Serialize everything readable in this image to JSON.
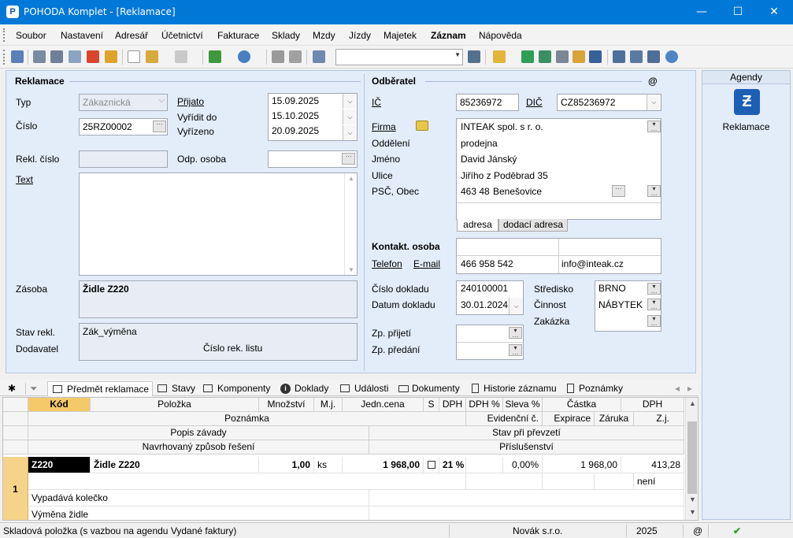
{
  "window": {
    "title": "POHODA Komplet - [Reklamace]",
    "minimize": "—",
    "maximize": "☐",
    "close": "✕"
  },
  "menu": [
    "Soubor",
    "Nastavení",
    "Adresář",
    "Účetnictví",
    "Fakturace",
    "Sklady",
    "Mzdy",
    "Jízdy",
    "Majetek",
    "Záznam",
    "Nápověda"
  ],
  "reklamace": {
    "section": "Reklamace",
    "typ_label": "Typ",
    "typ_value": "Zákaznická",
    "cislo_label": "Číslo",
    "cislo_value": "25RZ00002",
    "prijato_label": "Přijato",
    "prijato_value": "15.09.2025",
    "vyridit_label": "Vyřídit do",
    "vyridit_value": "15.10.2025",
    "vyrizeno_label": "Vyřízeno",
    "vyrizeno_value": "20.09.2025",
    "rekl_cislo_label": "Rekl. číslo",
    "rekl_cislo_value": "",
    "odp_osoba_label": "Odp. osoba",
    "odp_osoba_value": "",
    "text_label": "Text",
    "text_value": "",
    "zasoba_label": "Zásoba",
    "zasoba_value": "Židle Z220",
    "stav_label": "Stav rekl.",
    "stav_value": "Zák_výměna",
    "dodavatel_label": "Dodavatel",
    "cislo_rek_listu": "Číslo rek. listu"
  },
  "odberatel": {
    "section": "Odběratel",
    "at": "@",
    "ic_label": "IČ",
    "ic_value": "85236972",
    "dic_label": "DIČ",
    "dic_value": "CZ85236972",
    "firma_label": "Firma",
    "firma_value": "INTEAK spol. s r. o.",
    "oddeleni_label": "Oddělení",
    "oddeleni_value": "prodejna",
    "jmeno_label": "Jméno",
    "jmeno_value": "David Jánský",
    "ulice_label": "Ulice",
    "ulice_value": "Jiřího z Poděbrad 35",
    "psc_label": "PSČ, Obec",
    "psc_value": "463 48",
    "obec_value": "Benešovice",
    "tab_adresa": "adresa",
    "tab_dodaci": "dodací adresa",
    "kontakt_label": "Kontakt. osoba",
    "kontakt_value": "",
    "telefon_label": "Telefon",
    "email_label": "E-mail",
    "telefon_value": "466 958 542",
    "email_value": "info@inteak.cz",
    "cislo_dokladu_label": "Číslo dokladu",
    "cislo_dokladu_value": "240100001",
    "datum_dokladu_label": "Datum dokladu",
    "datum_dokladu_value": "30.01.2024",
    "stredisko_label": "Středisko",
    "stredisko_value": "BRNO",
    "cinnost_label": "Činnost",
    "cinnost_value": "NÁBYTEK",
    "zakazka_label": "Zakázka",
    "zakazka_value": "",
    "zp_prijeti_label": "Zp. přijetí",
    "zp_predani_label": "Zp. předání"
  },
  "agenda": {
    "header": "Agendy",
    "item": "Reklamace",
    "icon_glyph": "Ƶ"
  },
  "tabs": [
    "Předmět reklamace",
    "Stavy",
    "Komponenty",
    "Doklady",
    "Události",
    "Dokumenty",
    "Historie záznamu",
    "Poznámky"
  ],
  "tabs_nav": {
    "star": "✱",
    "prev": "◂",
    "next": "▸"
  },
  "grid": {
    "headers1": [
      "Kód",
      "Položka",
      "Množství",
      "M.j.",
      "Jedn.cena",
      "S",
      "DPH",
      "DPH %",
      "Sleva %",
      "Částka",
      "DPH"
    ],
    "headers2": [
      "Poznámka",
      "Evidenční č.",
      "Expirace",
      "Záruka",
      "Z.j."
    ],
    "headers3": [
      "Popis závady",
      "Stav při převzetí"
    ],
    "headers4": [
      "Navrhovaný způsob řešení",
      "Příslušenství"
    ],
    "row": {
      "num": "1",
      "kod": "Z220",
      "polozka": "Židle Z220",
      "mnozstvi": "1,00",
      "mj": "ks",
      "jedncena": "1 968,00",
      "dph": "21 %",
      "sleva": "0,00%",
      "castka": "1 968,00",
      "dph_castka": "413,28",
      "zj": "není",
      "popis_zavady": "Vypadává kolečko",
      "reseni": "Výměna židle"
    }
  },
  "status": {
    "text": "Skladová položka (s vazbou na agendu Vydané faktury)",
    "company": "Novák s.r.o.",
    "year": "2025",
    "at": "@",
    "check": "✔"
  },
  "colors": {
    "titlebar": "#0078d7",
    "form_bg": "#e3ecf9",
    "code_cell": "#000000",
    "row_num": "#f5d48a",
    "kod_header": "#f5c96a"
  },
  "icons": [
    "app-icon",
    "exit-icon",
    "copy-icon",
    "print-icon",
    "preview-icon",
    "pdf-icon",
    "export-icon",
    "new-icon",
    "tools-icon",
    "grid-icon",
    "back-icon",
    "settings-icon",
    "save-icon",
    "delete-icon",
    "duplicate-icon",
    "filter-icon",
    "folder-icon",
    "calc-icon",
    "iban-icon",
    "help-icon"
  ]
}
